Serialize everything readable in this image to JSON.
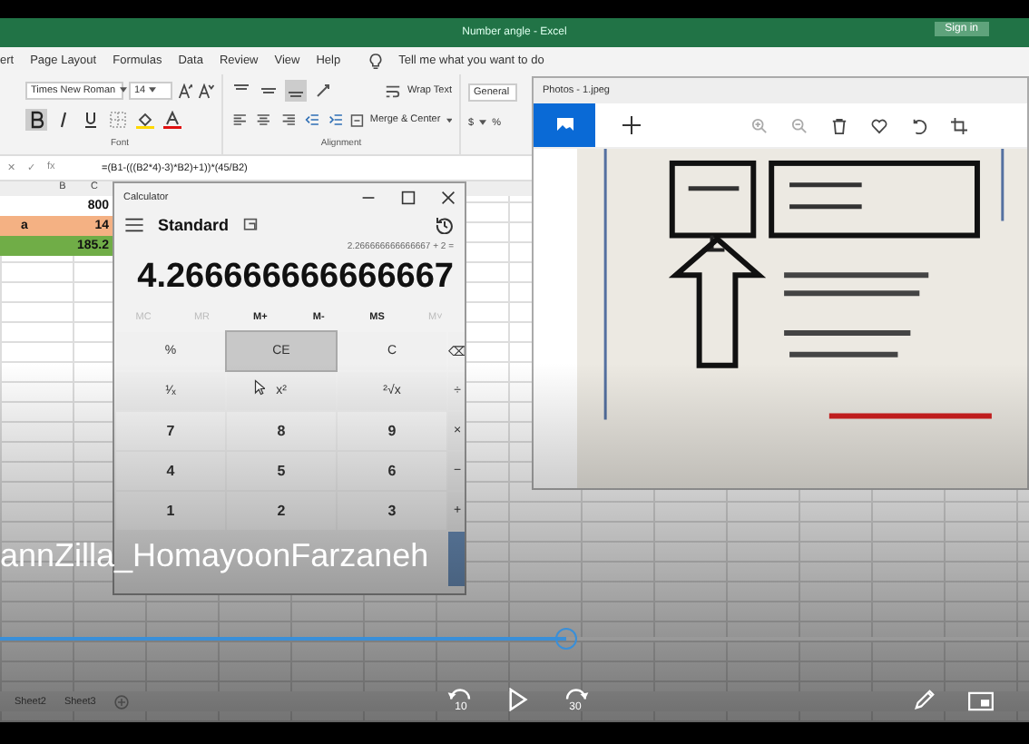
{
  "excel": {
    "title": "Number angle - Excel",
    "sign_in": "Sign in",
    "menu": [
      "ert",
      "Page Layout",
      "Formulas",
      "Data",
      "Review",
      "View",
      "Help"
    ],
    "tell_me": "Tell me what you want to do",
    "font": "Times New Roman",
    "font_size": "14",
    "wrap_text": "Wrap Text",
    "merge": "Merge & Center",
    "number_format": "General",
    "currency": "$",
    "percent": "%",
    "groups": [
      "Font",
      "Alignment"
    ],
    "formula_buttons": [
      "✕",
      "✓",
      "fx"
    ],
    "formula": "=(B1-(((B2*4)-3)*B2)+1))*(45/B2)",
    "column_headers": [
      "B",
      "C"
    ],
    "rows": [
      {
        "a": "",
        "b": "800",
        "color": "#ffffff"
      },
      {
        "a": "a",
        "b": "14",
        "color": "#f4b183"
      },
      {
        "a": "",
        "b": "185.2",
        "color": "#70ad47"
      }
    ],
    "sheets": [
      "Sheet2",
      "Sheet3"
    ]
  },
  "calculator": {
    "title": "Calculator",
    "mode": "Standard",
    "expression": "2.266666666666667 + 2 =",
    "display": "4.266666666666667",
    "memory": [
      {
        "label": "MC",
        "disabled": true
      },
      {
        "label": "MR",
        "disabled": true
      },
      {
        "label": "M+",
        "disabled": false
      },
      {
        "label": "M-",
        "disabled": false
      },
      {
        "label": "MS",
        "disabled": false
      },
      {
        "label": "M˅",
        "disabled": true
      }
    ],
    "keys": [
      {
        "label": "%",
        "kind": "fn",
        "hover": false
      },
      {
        "label": "CE",
        "kind": "fn",
        "hover": true
      },
      {
        "label": "C",
        "kind": "fn",
        "hover": false
      },
      {
        "label": "⌫",
        "kind": "fn",
        "hover": false
      },
      {
        "label": "¹⁄ₓ",
        "kind": "fn",
        "hover": false
      },
      {
        "label": "x²",
        "kind": "fn",
        "hover": false
      },
      {
        "label": "²√x",
        "kind": "fn",
        "hover": false
      },
      {
        "label": "÷",
        "kind": "fn",
        "hover": false
      },
      {
        "label": "7",
        "kind": "num",
        "hover": false
      },
      {
        "label": "8",
        "kind": "num",
        "hover": false
      },
      {
        "label": "9",
        "kind": "num",
        "hover": false
      },
      {
        "label": "×",
        "kind": "fn",
        "hover": false
      },
      {
        "label": "4",
        "kind": "num",
        "hover": false
      },
      {
        "label": "5",
        "kind": "num",
        "hover": false
      },
      {
        "label": "6",
        "kind": "num",
        "hover": false
      },
      {
        "label": "−",
        "kind": "fn",
        "hover": false
      },
      {
        "label": "1",
        "kind": "num",
        "hover": false
      },
      {
        "label": "2",
        "kind": "num",
        "hover": false
      },
      {
        "label": "3",
        "kind": "num",
        "hover": false
      },
      {
        "label": "+",
        "kind": "fn",
        "hover": false
      },
      {
        "kind": "equals",
        "hover": false
      }
    ]
  },
  "photos": {
    "title": "Photos - 1.jpeg"
  },
  "video": {
    "title": "annZilla_HomayoonFarzaneh",
    "progress": {
      "level": 0.55
    },
    "rewind": "10",
    "forward": "30"
  }
}
